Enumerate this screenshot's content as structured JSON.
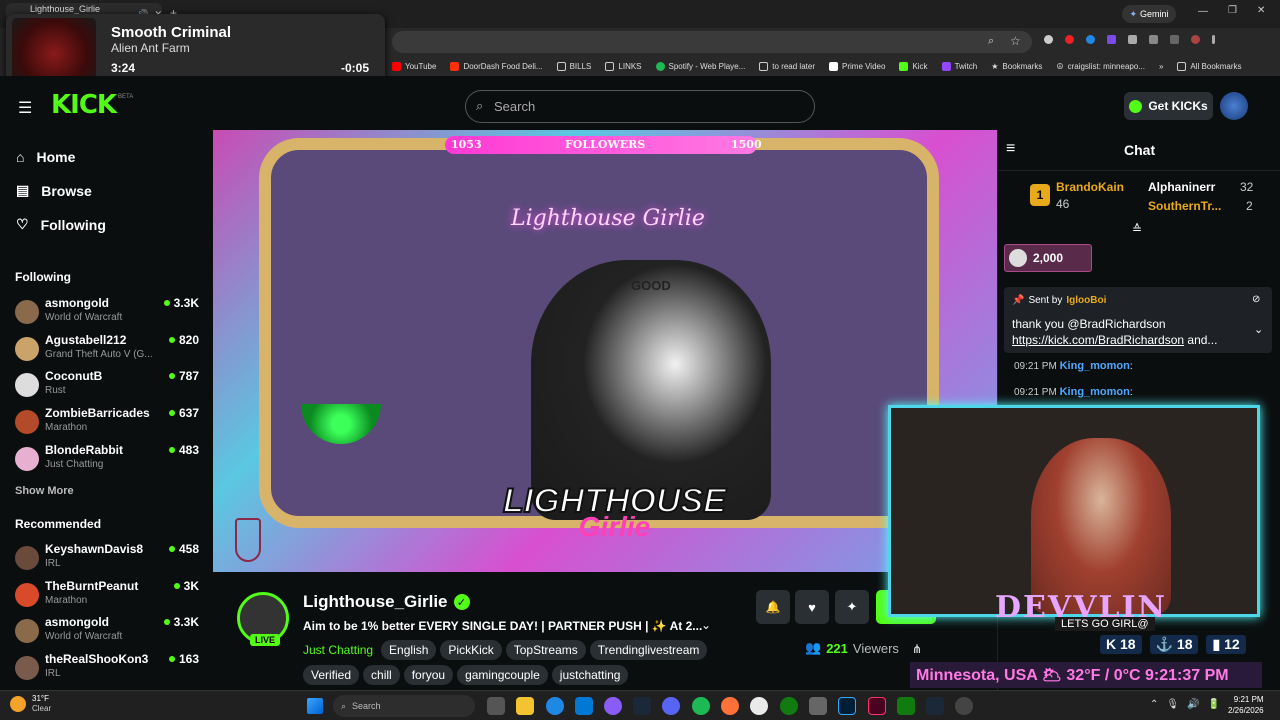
{
  "browser": {
    "tab_title": "Lighthouse_Girlie Stream -",
    "gemini_label": "Gemini",
    "bookmarks": [
      "YouTube",
      "DoorDash Food Deli...",
      "BILLS",
      "LINKS",
      "Spotify - Web Playe...",
      "to read later",
      "Prime Video",
      "Kick",
      "Twitch",
      "Bookmarks",
      "craigslist: minneapo..."
    ],
    "all_bookmarks": "All Bookmarks"
  },
  "media": {
    "title": "Smooth Criminal",
    "artist": "Alien Ant Farm",
    "elapsed": "3:24",
    "remaining": "-0:05",
    "progress": 0.97
  },
  "header": {
    "logo": "KICK",
    "beta": "BETA",
    "search_placeholder": "Search",
    "get_kicks": "Get KICKs"
  },
  "sidebar": {
    "nav": [
      {
        "label": "Home",
        "icon": "home-icon"
      },
      {
        "label": "Browse",
        "icon": "browse-icon"
      },
      {
        "label": "Following",
        "icon": "heart-icon"
      }
    ],
    "following_heading": "Following",
    "following": [
      {
        "name": "asmongold",
        "game": "World of Warcraft",
        "viewers": "3.3K",
        "color": "#8a6a4a"
      },
      {
        "name": "Agustabell212",
        "game": "Grand Theft Auto V (G...",
        "viewers": "820",
        "color": "#c9a36a"
      },
      {
        "name": "CoconutB",
        "game": "Rust",
        "viewers": "787",
        "color": "#ddd"
      },
      {
        "name": "ZombieBarricades",
        "game": "Marathon",
        "viewers": "637",
        "color": "#b34a2a"
      },
      {
        "name": "BlondeRabbit",
        "game": "Just Chatting",
        "viewers": "483",
        "color": "#e8b0d0"
      }
    ],
    "show_more": "Show More",
    "recommended_heading": "Recommended",
    "recommended": [
      {
        "name": "KeyshawnDavis8",
        "game": "IRL",
        "viewers": "458",
        "color": "#6a4a3a"
      },
      {
        "name": "TheBurntPeanut",
        "game": "Marathon",
        "viewers": "3K",
        "color": "#d84a2a"
      },
      {
        "name": "asmongold",
        "game": "World of Warcraft",
        "viewers": "3.3K",
        "color": "#8a6a4a"
      },
      {
        "name": "theRealShooKon3",
        "game": "IRL",
        "viewers": "163",
        "color": "#7a5a4a"
      }
    ]
  },
  "video": {
    "goal_start": "1053",
    "goal_label": "FOLLOWERS",
    "goal_end": "1500",
    "neon_sign": "Lighthouse Girlie",
    "logo_text_1": "LIGHTHOUSE",
    "logo_text_2": "Girlie",
    "hat_text": "GOOD"
  },
  "stream": {
    "channel": "Lighthouse_Girlie",
    "live_badge": "LIVE",
    "title": "Aim to be 1% better EVERY SINGLE DAY! | PARTNER PUSH | ✨ At 2...",
    "category": "Just Chatting",
    "tags_row1": [
      "English",
      "PickKick",
      "TopStreams",
      "Trendinglivestream"
    ],
    "tags_row2": [
      "Verified",
      "chill",
      "foryou",
      "gamingcouple",
      "justchatting"
    ],
    "viewers": "221",
    "viewers_label": "Viewers"
  },
  "chat": {
    "heading": "Chat",
    "leaderboard": [
      {
        "rank": "1",
        "name": "BrandoKain",
        "count": "46"
      },
      {
        "name": "Alphaninerr",
        "count": "32"
      },
      {
        "name": "SouthernTr...",
        "count": "2"
      }
    ],
    "kicks_amount": "2,000",
    "pinned": {
      "sent_by": "Sent by",
      "sender": "IglooBoi",
      "message": "thank you @BradRichardson",
      "link": "https://kick.com/BradRichardson",
      "link_suffix": " and..."
    },
    "messages": [
      {
        "time": "09:21 PM",
        "user": "King_momon"
      },
      {
        "time": "09:21 PM",
        "user": "King_momon"
      }
    ]
  },
  "cam_overlay": {
    "name": "DEVVLIN",
    "chat_snippet": "LETS GO GIRL@",
    "stat1": "18",
    "stat2": "18",
    "stat3": "12",
    "weather": "Minnesota, USA 🌥 32°F / 0°C 9:21:37 PM"
  },
  "taskbar": {
    "weather_temp": "31°F",
    "weather_cond": "Clear",
    "search_placeholder": "Search",
    "time": "9:21 PM",
    "date": "2/26/2026"
  },
  "colors": {
    "kick_green": "#53fc18",
    "bg": "#0b0e0f",
    "accent_pink": "#ff39d4"
  }
}
